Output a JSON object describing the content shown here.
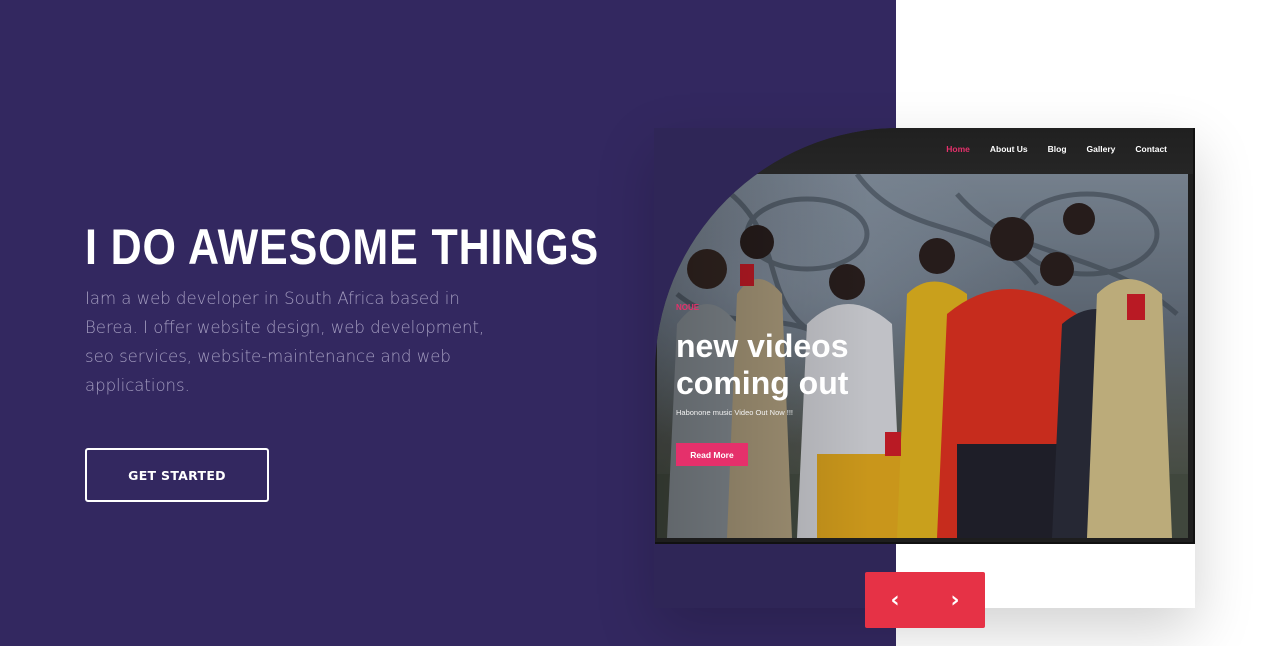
{
  "hero": {
    "title": "I DO AWESOME THINGS",
    "description": "Iam a web developer in South Africa based in Berea. I offer website design, web development, seo services, website-maintenance and web applications.",
    "cta_label": "GET STARTED"
  },
  "mockup": {
    "nav": [
      "Home",
      "About Us",
      "Blog",
      "Gallery",
      "Contact"
    ],
    "active_nav": "Home",
    "tag": "NOUE",
    "headline": "new videos coming out",
    "subtext": "Habonone music Video Out Now !!!",
    "button_label": "Read More"
  },
  "slider": {
    "prev_icon": "chevron-left-icon",
    "next_icon": "chevron-right-icon"
  },
  "colors": {
    "hero_bg": "#332860",
    "accent_pink": "#e5306b",
    "slider_red": "#e63246",
    "muted_text": "#a39cbf"
  }
}
